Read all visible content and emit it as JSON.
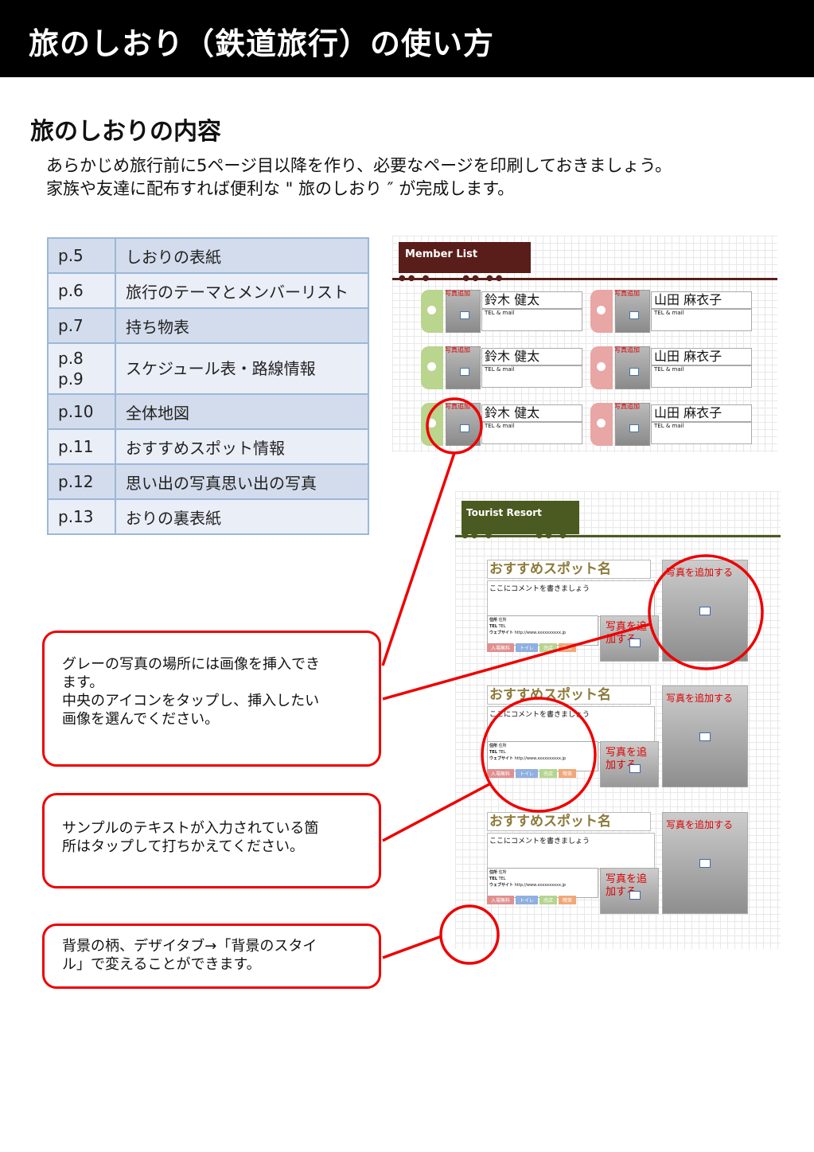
{
  "header": {
    "title": "旅のしおり（鉄道旅行）の使い方"
  },
  "section": {
    "title": "旅のしおりの内容"
  },
  "intro": {
    "line1": "あらかじめ旅行前に5ページ目以降を作り、必要なページを印刷しておきましょう。",
    "line2": "家族や友達に配布すれば便利な \" 旅のしおり ″ が完成します。"
  },
  "pages_table": [
    {
      "page": "p.5",
      "content": "しおりの表紙"
    },
    {
      "page": "p.6",
      "content": "旅行のテーマとメンバーリスト"
    },
    {
      "page": "p.7",
      "content": "持ち物表"
    },
    {
      "page": "p.8\np.9",
      "content": "スケジュール表・路線情報"
    },
    {
      "page": "p.10",
      "content": "全体地図"
    },
    {
      "page": "p.11",
      "content": "おすすめスポット情報"
    },
    {
      "page": "p.12",
      "content": "思い出の写真思い出の写真"
    },
    {
      "page": "p.13",
      "content": "おりの裏表紙"
    }
  ],
  "member_list": {
    "title": "Member List",
    "photo_caption": "写真追加",
    "tel_label": "TEL & mail",
    "members": [
      {
        "name": "鈴木 健太",
        "color": "#b9d58e"
      },
      {
        "name": "山田 麻衣子",
        "color": "#e8a6a4"
      },
      {
        "name": "鈴木 健太",
        "color": "#b9d58e"
      },
      {
        "name": "山田 麻衣子",
        "color": "#e8a6a4"
      },
      {
        "name": "鈴木 健太",
        "color": "#b9d58e"
      },
      {
        "name": "山田 麻衣子",
        "color": "#e8a6a4"
      }
    ]
  },
  "tourist": {
    "title": "Tourist Resort",
    "spot_name": "おすすめスポット名",
    "comment": "ここにコメントを書きましょう",
    "address_label": "住所",
    "address_value": "住所",
    "tel_label": "TEL",
    "tel_value": "TEL",
    "web_label": "ウェブサイト",
    "web_value": "http://www.xxxxxxxxxx.jp",
    "chips": [
      "入場無料",
      "トイレ",
      "売店",
      "喫茶"
    ],
    "small_photo": "写真を追加する",
    "big_photo": "写真を追加する"
  },
  "callouts": {
    "c1_l1": "グレーの写真の場所には画像を挿入でき",
    "c1_l2": "ます。",
    "c1_l3": "中央のアイコンをタップし、挿入したい",
    "c1_l4": "画像を選んでください。",
    "c2_l1": "サンプルのテキストが入力されている箇",
    "c2_l2": "所はタップして打ちかえてください。",
    "c3_l1": "背景の柄、デザイタブ→「背景のスタイ",
    "c3_l2": "ル」で変えることができます。"
  },
  "colors": {
    "accent": "#e00000",
    "member_tag": "#5a1e1a",
    "tourist_tag": "#4b5a20",
    "table_border": "#9cb7d9"
  }
}
